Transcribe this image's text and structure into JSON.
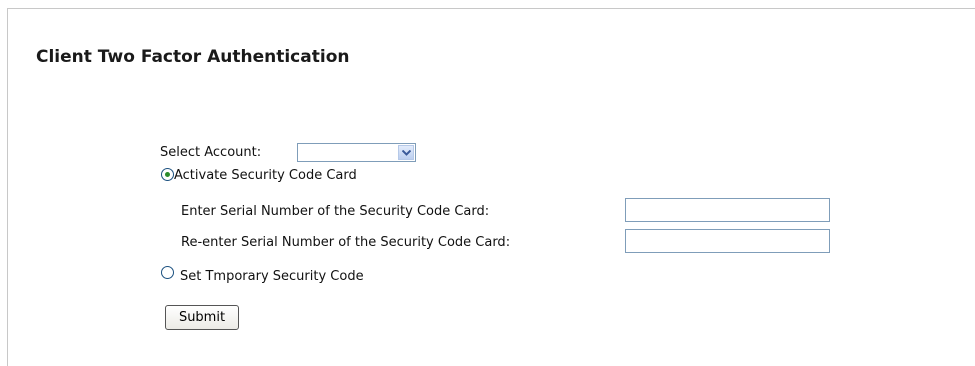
{
  "page": {
    "title": "Client Two Factor Authentication"
  },
  "form": {
    "select_account_label": "Select Account:",
    "select_account_value": "",
    "options": {
      "activate": {
        "label": "Activate Security Code Card",
        "checked": true
      },
      "temporary": {
        "label": "Set Tmporary Security Code",
        "checked": false
      }
    },
    "serial_label": "Enter Serial Number of the Security Code Card:",
    "serial_value": "",
    "reenter_serial_label": "Re-enter Serial Number of the Security Code Card:",
    "reenter_serial_value": "",
    "submit_label": "Submit"
  },
  "colors": {
    "radio_dot": "#2a8b2a",
    "input_border": "#7f9db9"
  }
}
